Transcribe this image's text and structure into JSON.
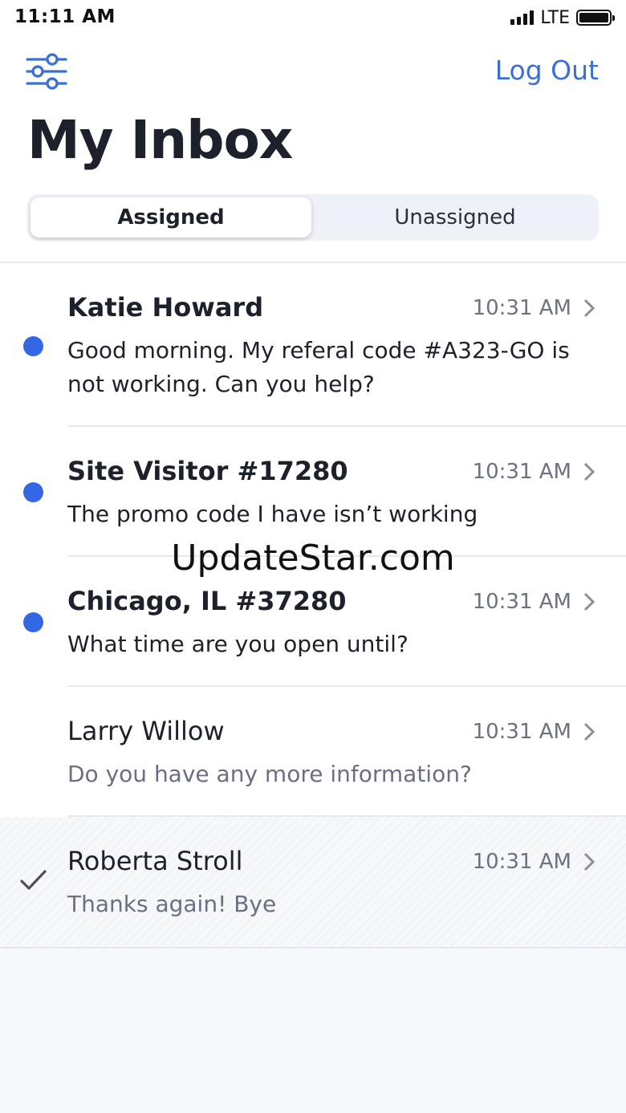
{
  "status_bar": {
    "time": "11:11 AM",
    "network": "LTE"
  },
  "header": {
    "filter_icon": "sliders-icon",
    "logout_label": "Log Out",
    "title": "My Inbox"
  },
  "tabs": [
    {
      "label": "Assigned",
      "selected": true
    },
    {
      "label": "Unassigned",
      "selected": false
    }
  ],
  "conversations": [
    {
      "name": "Katie Howard",
      "time": "10:31 AM",
      "message": "Good morning. My referal code #A323-GO is not working. Can you help?",
      "unread": true
    },
    {
      "name": "Site Visitor #17280",
      "time": "10:31 AM",
      "message": "The promo code I have isn’t working",
      "unread": true
    },
    {
      "name": "Chicago, IL #37280",
      "time": "10:31 AM",
      "message": "What time are you open until?",
      "unread": true
    },
    {
      "name": "Larry Willow",
      "time": "10:31 AM",
      "message": "Do you have any more information?",
      "unread": false
    },
    {
      "name": "Roberta Stroll",
      "time": "10:31 AM",
      "message": "Thanks again! Bye",
      "unread": false,
      "resolved": true
    }
  ],
  "watermark": "UpdateStar.com",
  "colors": {
    "accent": "#3b6fd8",
    "unread_dot": "#3367e3",
    "title": "#1d212b",
    "muted": "#6a7081"
  }
}
